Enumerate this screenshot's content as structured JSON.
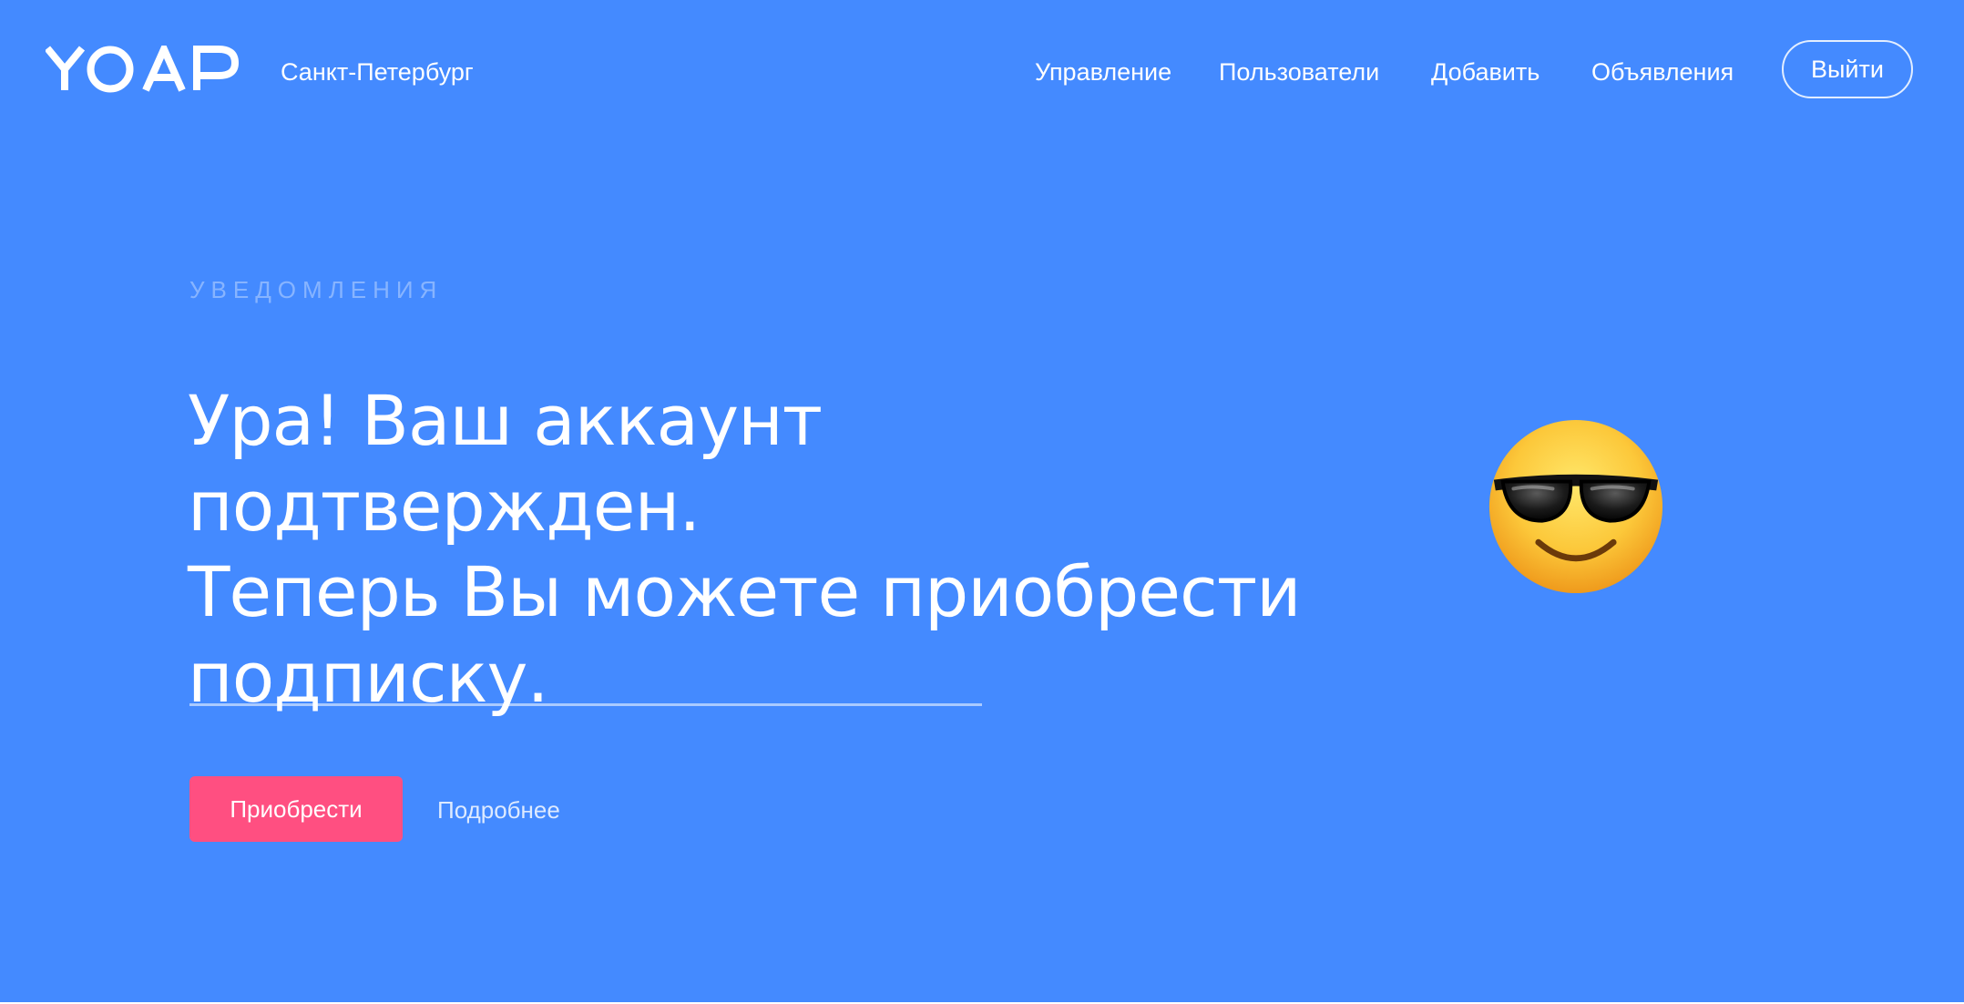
{
  "header": {
    "logo_text": "YOAP",
    "city": "Санкт-Петербург",
    "nav": [
      "Управление",
      "Пользователи",
      "Добавить",
      "Объявления"
    ],
    "logout_label": "Выйти"
  },
  "hero": {
    "eyebrow": "УВЕДОМЛЕНИЯ",
    "headline_lines": [
      "Ура! Ваш аккаунт подтвержден.",
      "Теперь Вы можете приобрести",
      "подписку."
    ],
    "primary_button": "Приобрести",
    "secondary_link": "Подробнее",
    "emoji": "smiling-face-with-sunglasses-icon"
  },
  "colors": {
    "background": "#448aff",
    "accent_button": "#ff4f81",
    "text": "#ffffff"
  }
}
